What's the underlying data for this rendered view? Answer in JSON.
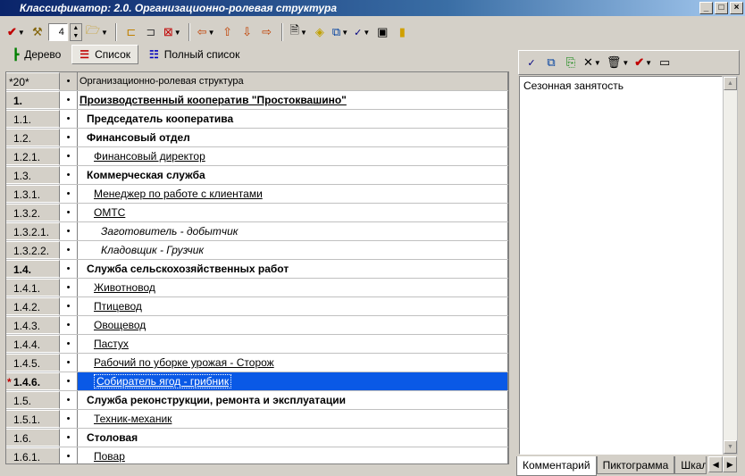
{
  "window": {
    "title": "Классификатор: 2.0. Организационно-ролевая структура",
    "controls": {
      "minimize": "_",
      "maximize": "□",
      "close": "×"
    }
  },
  "toolbar": {
    "level_value": "4"
  },
  "view_tabs": [
    {
      "label": "Дерево",
      "active": false
    },
    {
      "label": "Список",
      "active": true
    },
    {
      "label": "Полный список",
      "active": false
    }
  ],
  "grid": {
    "header": {
      "count": "*20*",
      "dot": "•",
      "title": "Организационно-ролевая структура"
    },
    "rows": [
      {
        "num": "1.",
        "name": "Производственный кооператив \"Простоквашино\"",
        "level": 0,
        "bold": true,
        "underline": true,
        "italic": false,
        "numbold": true
      },
      {
        "num": "1.1.",
        "name": "Председатель кооператива",
        "level": 1,
        "bold": true,
        "underline": false,
        "italic": false
      },
      {
        "num": "1.2.",
        "name": "Финансовый отдел",
        "level": 1,
        "bold": true,
        "underline": false,
        "italic": false
      },
      {
        "num": "1.2.1.",
        "name": "Финансовый директор",
        "level": 2,
        "bold": false,
        "underline": true,
        "italic": false
      },
      {
        "num": "1.3.",
        "name": "Коммерческая служба",
        "level": 1,
        "bold": true,
        "underline": false,
        "italic": false
      },
      {
        "num": "1.3.1.",
        "name": "Менеджер по работе с клиентами",
        "level": 2,
        "bold": false,
        "underline": true,
        "italic": false
      },
      {
        "num": "1.3.2.",
        "name": "ОМТС",
        "level": 2,
        "bold": false,
        "underline": true,
        "italic": false
      },
      {
        "num": "1.3.2.1.",
        "name": "Заготовитель - добытчик",
        "level": 3,
        "bold": false,
        "underline": false,
        "italic": true
      },
      {
        "num": "1.3.2.2.",
        "name": "Кладовщик - Грузчик",
        "level": 3,
        "bold": false,
        "underline": false,
        "italic": true
      },
      {
        "num": "1.4.",
        "name": "Служба сельскохозяйственных работ",
        "level": 1,
        "bold": true,
        "underline": false,
        "italic": false,
        "numbold": true
      },
      {
        "num": "1.4.1.",
        "name": "Животновод",
        "level": 2,
        "bold": false,
        "underline": true,
        "italic": false
      },
      {
        "num": "1.4.2.",
        "name": "Птицевод",
        "level": 2,
        "bold": false,
        "underline": true,
        "italic": false
      },
      {
        "num": "1.4.3.",
        "name": "Овощевод",
        "level": 2,
        "bold": false,
        "underline": true,
        "italic": false
      },
      {
        "num": "1.4.4.",
        "name": "Пастух",
        "level": 2,
        "bold": false,
        "underline": true,
        "italic": false
      },
      {
        "num": "1.4.5.",
        "name": "Рабочий по уборке урожая - Сторож",
        "level": 2,
        "bold": false,
        "underline": true,
        "italic": false
      },
      {
        "num": "1.4.6.",
        "name": "Собиратель ягод - грибник",
        "level": 2,
        "bold": false,
        "underline": true,
        "italic": false,
        "selected": true,
        "numbold": true,
        "marker": "*"
      },
      {
        "num": "1.5.",
        "name": "Служба реконструкции, ремонта и эксплуатации",
        "level": 1,
        "bold": true,
        "underline": false,
        "italic": false
      },
      {
        "num": "1.5.1.",
        "name": "Техник-механик",
        "level": 2,
        "bold": false,
        "underline": true,
        "italic": false
      },
      {
        "num": "1.6.",
        "name": "Столовая",
        "level": 1,
        "bold": true,
        "underline": false,
        "italic": false
      },
      {
        "num": "1.6.1.",
        "name": "Повар",
        "level": 2,
        "bold": false,
        "underline": true,
        "italic": false
      }
    ]
  },
  "right_panel": {
    "memo_text": "Сезонная занятость",
    "tabs": [
      "Комментарий",
      "Пиктограмма",
      "Шкал"
    ],
    "active_tab": 0
  },
  "colors": {
    "selection": "#0a59e6",
    "title_gradient_start": "#0a246a",
    "face": "#d4d0c8"
  }
}
